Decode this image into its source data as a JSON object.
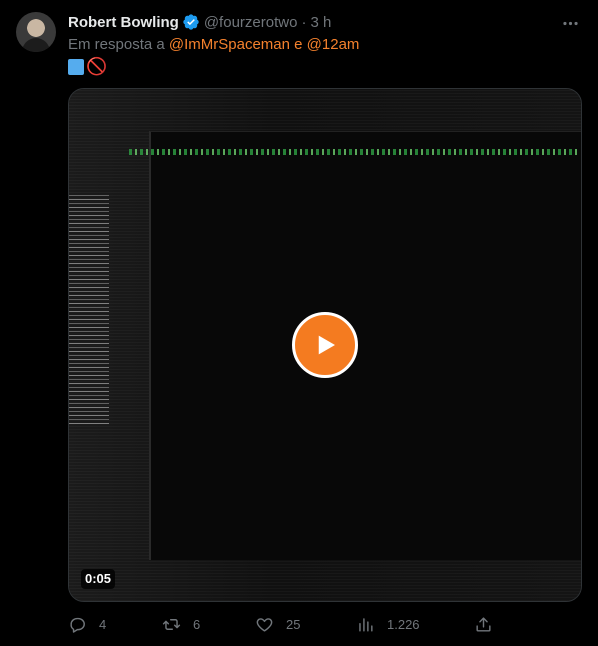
{
  "tweet": {
    "author_name": "Robert Bowling",
    "handle": "@fourzerotwo",
    "separator": "·",
    "time": "3 h",
    "reply_prefix": "Em resposta a",
    "reply_to_1": "@ImMrSpaceman",
    "reply_conjunction": "e",
    "reply_to_2": "@12am",
    "emoji": [
      "blue-square",
      "no-entry"
    ],
    "no_entry_glyph": "🚫"
  },
  "media": {
    "duration": "0:05",
    "play_button_color": "#f47b20"
  },
  "actions": {
    "replies": "4",
    "retweets": "6",
    "likes": "25",
    "views": "1.226"
  },
  "colors": {
    "link": "#f4812d",
    "verified": "#1d9bf0",
    "muted": "#71767b"
  }
}
